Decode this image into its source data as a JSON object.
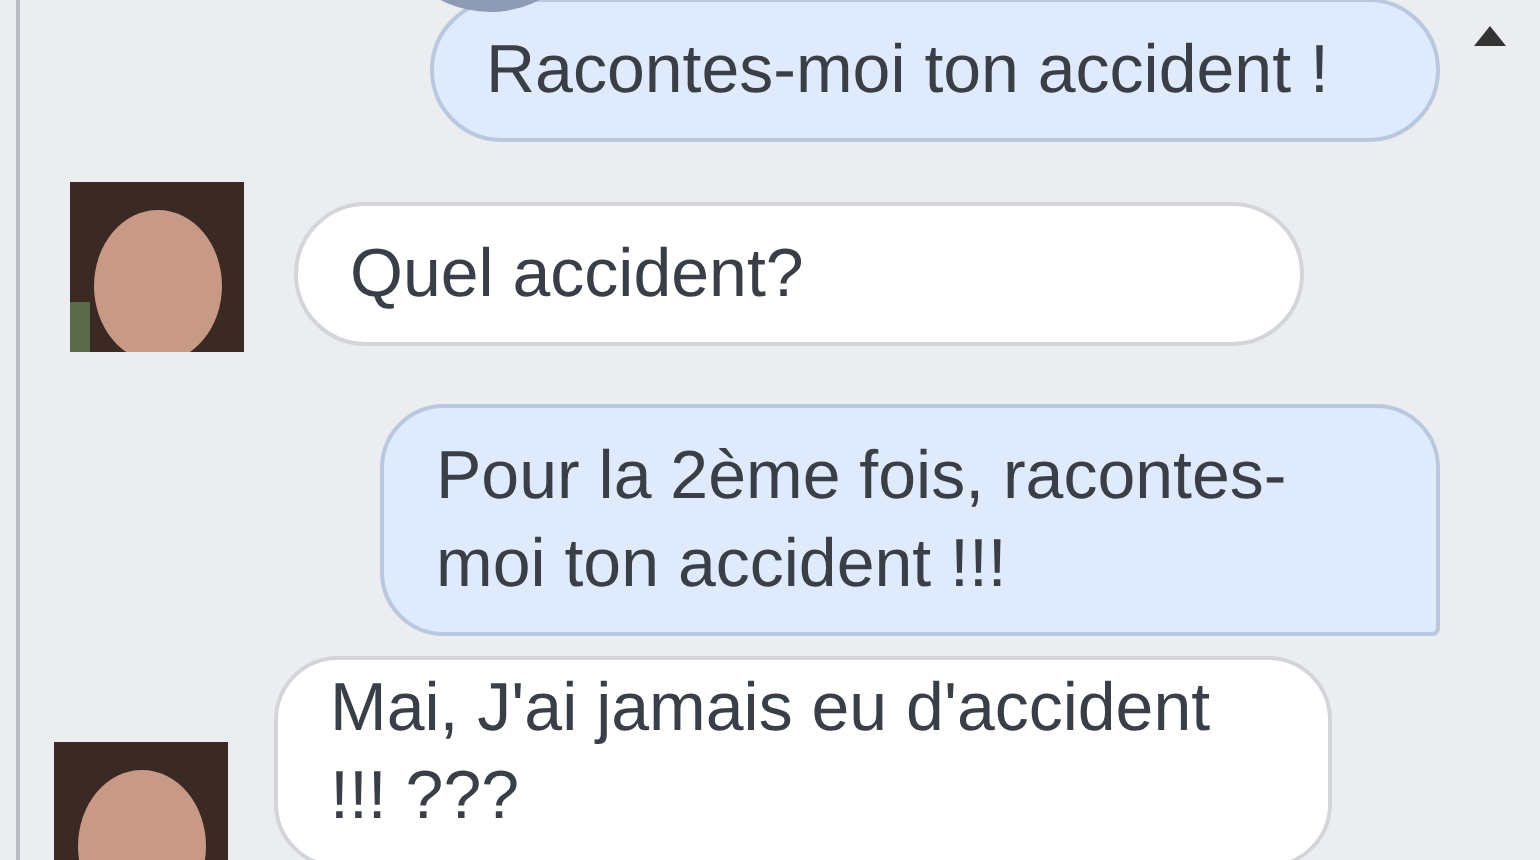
{
  "messages": [
    {
      "kind": "outgoing",
      "text": "Racontes-moi ton accident !"
    },
    {
      "kind": "incoming",
      "text": "Quel accident?"
    },
    {
      "kind": "outgoing",
      "text": "Pour la 2ème fois, racontes-moi ton accident !!!"
    },
    {
      "kind": "incoming",
      "text": "Mai, J'ai jamais eu d'accident !!! ???"
    }
  ]
}
